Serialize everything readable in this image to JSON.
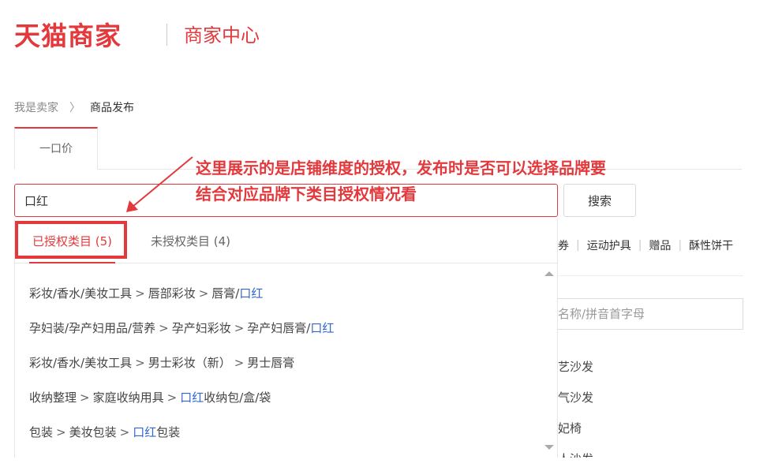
{
  "header": {
    "brand": "天猫商家",
    "subtitle": "商家中心"
  },
  "breadcrumb": {
    "home": "我是卖家",
    "separator": "〉",
    "current": "商品发布"
  },
  "type_tab": {
    "label": "一口价"
  },
  "search": {
    "value": "口红",
    "button_label": "搜索"
  },
  "annotation": {
    "line1": "这里展示的是店铺维度的授权，发布时是否可以选择品牌要",
    "line2": "结合对应品牌下类目授权情况看"
  },
  "dropdown": {
    "tab_authorized": "已授权类目 (5)",
    "tab_unauthorized": "未授权类目 (4)",
    "items": [
      {
        "p1": "彩妆/香水/美妆工具",
        "p2": "唇部彩妆",
        "p3": "唇膏/",
        "hl": "口红",
        "tail": ""
      },
      {
        "p1": "孕妇装/孕产妇用品/营养",
        "p2": "孕产妇彩妆",
        "p3": "孕产妇唇膏/",
        "hl": "口红",
        "tail": ""
      },
      {
        "p1": "彩妆/香水/美妆工具",
        "p2": "男士彩妆（新）",
        "p3": "男士唇膏",
        "hl": "",
        "tail": ""
      },
      {
        "p1": "收纳整理",
        "p2": "家庭收纳用具",
        "p3": "",
        "hl": "口红",
        "tail": "收纳包/盒/袋"
      },
      {
        "p1": "包装",
        "p2": "美妆包装",
        "p3": "",
        "hl": "口红",
        "tail": "包装"
      }
    ],
    "gt": ">"
  },
  "right_panel": {
    "categories": [
      "券",
      "运动护具",
      "赠品",
      "酥性饼干"
    ],
    "sep": "|",
    "input_placeholder": "名称/拼音首字母",
    "items": [
      "艺沙发",
      "气沙发",
      "妃椅",
      "人沙发"
    ]
  },
  "colors": {
    "accent": "#e4393c",
    "link": "#3366cc"
  }
}
